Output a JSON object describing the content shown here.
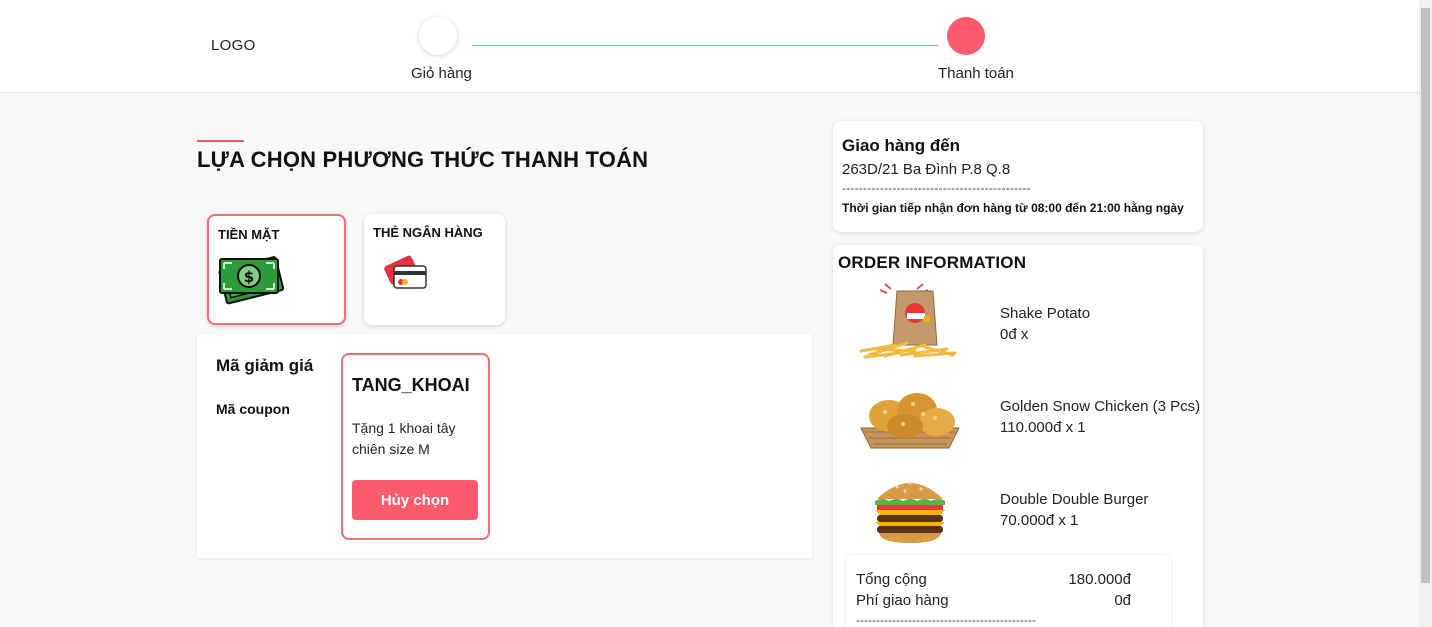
{
  "header": {
    "logo": "LOGO",
    "steps": [
      {
        "label": "Giỏ hàng",
        "active": false
      },
      {
        "label": "Thanh toán",
        "active": true
      }
    ]
  },
  "payment": {
    "title": "LỰA CHỌN PHƯƠNG THỨC THANH TOÁN",
    "methods": [
      {
        "label": "TIỀN MẶT",
        "icon": "cash-icon",
        "selected": true
      },
      {
        "label": "THẺ NGÂN HÀNG",
        "icon": "bank-card-icon",
        "selected": false
      }
    ]
  },
  "coupon": {
    "title": "Mã giảm giá",
    "subtitle": "Mã coupon",
    "code": "TANG_KHOAI",
    "description": "Tặng 1 khoai tây chiên size M",
    "button": "Hủy chọn"
  },
  "delivery": {
    "title": "Giao hàng đến",
    "address": "263D/21 Ba Đình P.8 Q.8",
    "separator": "---------------------------------------------",
    "hours": "Thời gian tiếp nhận đơn hàng từ 08:00 đến 21:00 hằng ngày"
  },
  "order": {
    "title": "ORDER INFORMATION",
    "items": [
      {
        "name": "Shake Potato",
        "price": "0đ x",
        "image": "fries-bag-image"
      },
      {
        "name": "Golden Snow Chicken (3 Pcs)",
        "price": "110.000đ x 1",
        "image": "fried-chicken-image"
      },
      {
        "name": "Double Double Burger",
        "price": "70.000đ x 1",
        "image": "burger-image"
      }
    ],
    "totals": {
      "total_label": "Tổng cộng",
      "total_value": "180.000đ",
      "shipping_label": "Phí giao hàng",
      "shipping_value": "0đ",
      "separator": "---------------------------------------------"
    }
  },
  "colors": {
    "accent": "#fc5a6d",
    "border_selected": "#f36c78",
    "step_line": "#f38a93"
  }
}
